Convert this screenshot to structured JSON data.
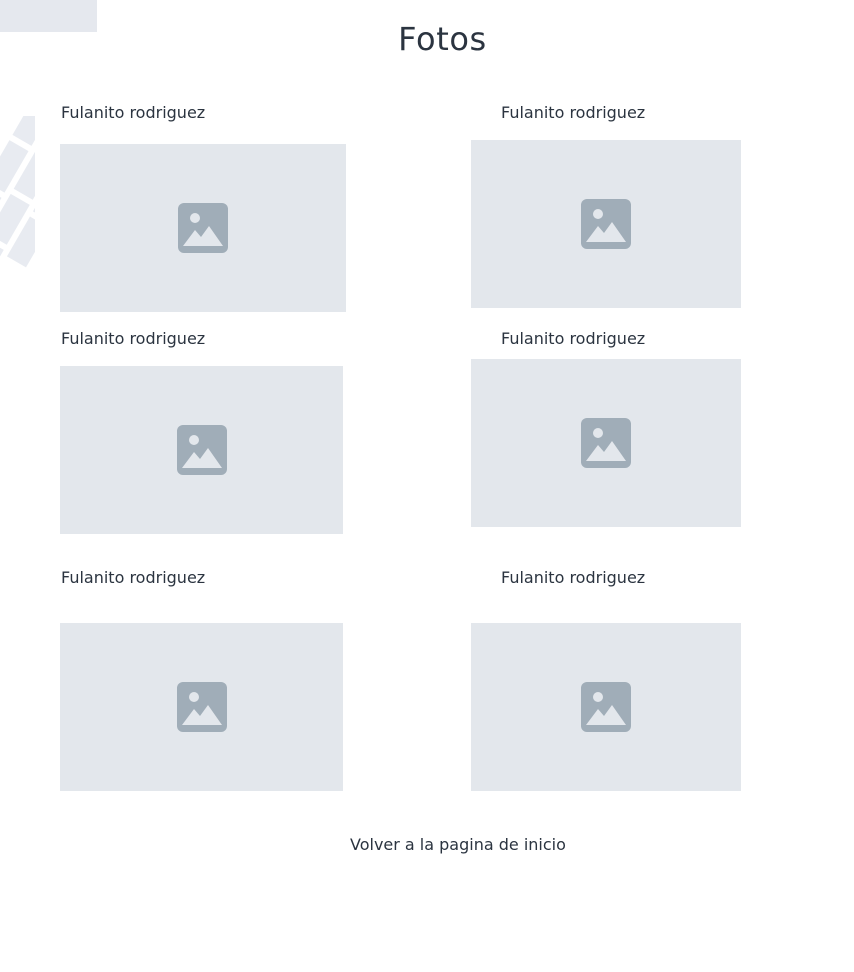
{
  "page": {
    "title": "Fotos"
  },
  "gallery": {
    "items": [
      {
        "caption": "Fulanito rodriguez",
        "image": "image-placeholder-icon"
      },
      {
        "caption": "Fulanito rodriguez",
        "image": "image-placeholder-icon"
      },
      {
        "caption": "Fulanito rodriguez",
        "image": "image-placeholder-icon"
      },
      {
        "caption": "Fulanito rodriguez",
        "image": "image-placeholder-icon"
      },
      {
        "caption": "Fulanito rodriguez",
        "image": "image-placeholder-icon"
      },
      {
        "caption": "Fulanito rodriguez",
        "image": "image-placeholder-icon"
      }
    ]
  },
  "footer": {
    "back_link": "Volver a la pagina de inicio"
  },
  "colors": {
    "text": "#2b3440",
    "placeholder_bg": "#e3e7ec",
    "placeholder_icon": "#a0adb8",
    "decoration": "#e5e8ee"
  }
}
